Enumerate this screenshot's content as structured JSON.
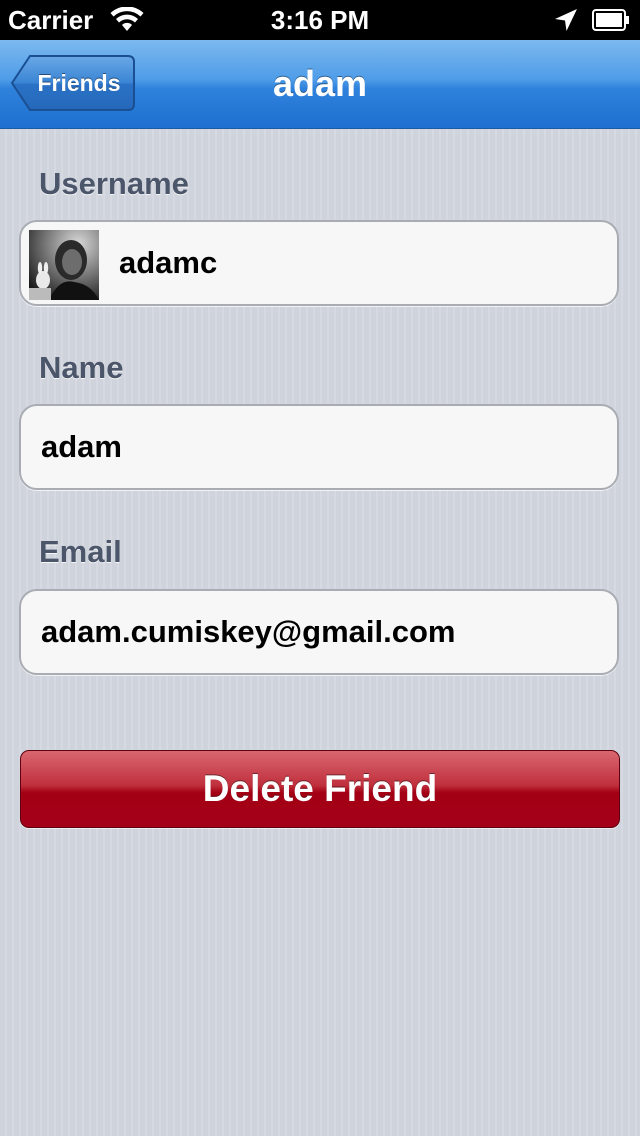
{
  "status_bar": {
    "carrier": "Carrier",
    "time": "3:16 PM",
    "icons": [
      "wifi-icon",
      "location-arrow-icon",
      "battery-icon"
    ]
  },
  "nav": {
    "back_label": "Friends",
    "title": "adam"
  },
  "fields": {
    "username": {
      "label": "Username",
      "value": "adamc"
    },
    "name": {
      "label": "Name",
      "value": "adam"
    },
    "email": {
      "label": "Email",
      "value": "adam.cumiskey@gmail.com"
    }
  },
  "actions": {
    "delete_label": "Delete Friend"
  },
  "colors": {
    "nav_blue": "#2f82dc",
    "delete_red": "#a30014",
    "label_slate": "#4c566a",
    "background": "#cfd3dc"
  }
}
